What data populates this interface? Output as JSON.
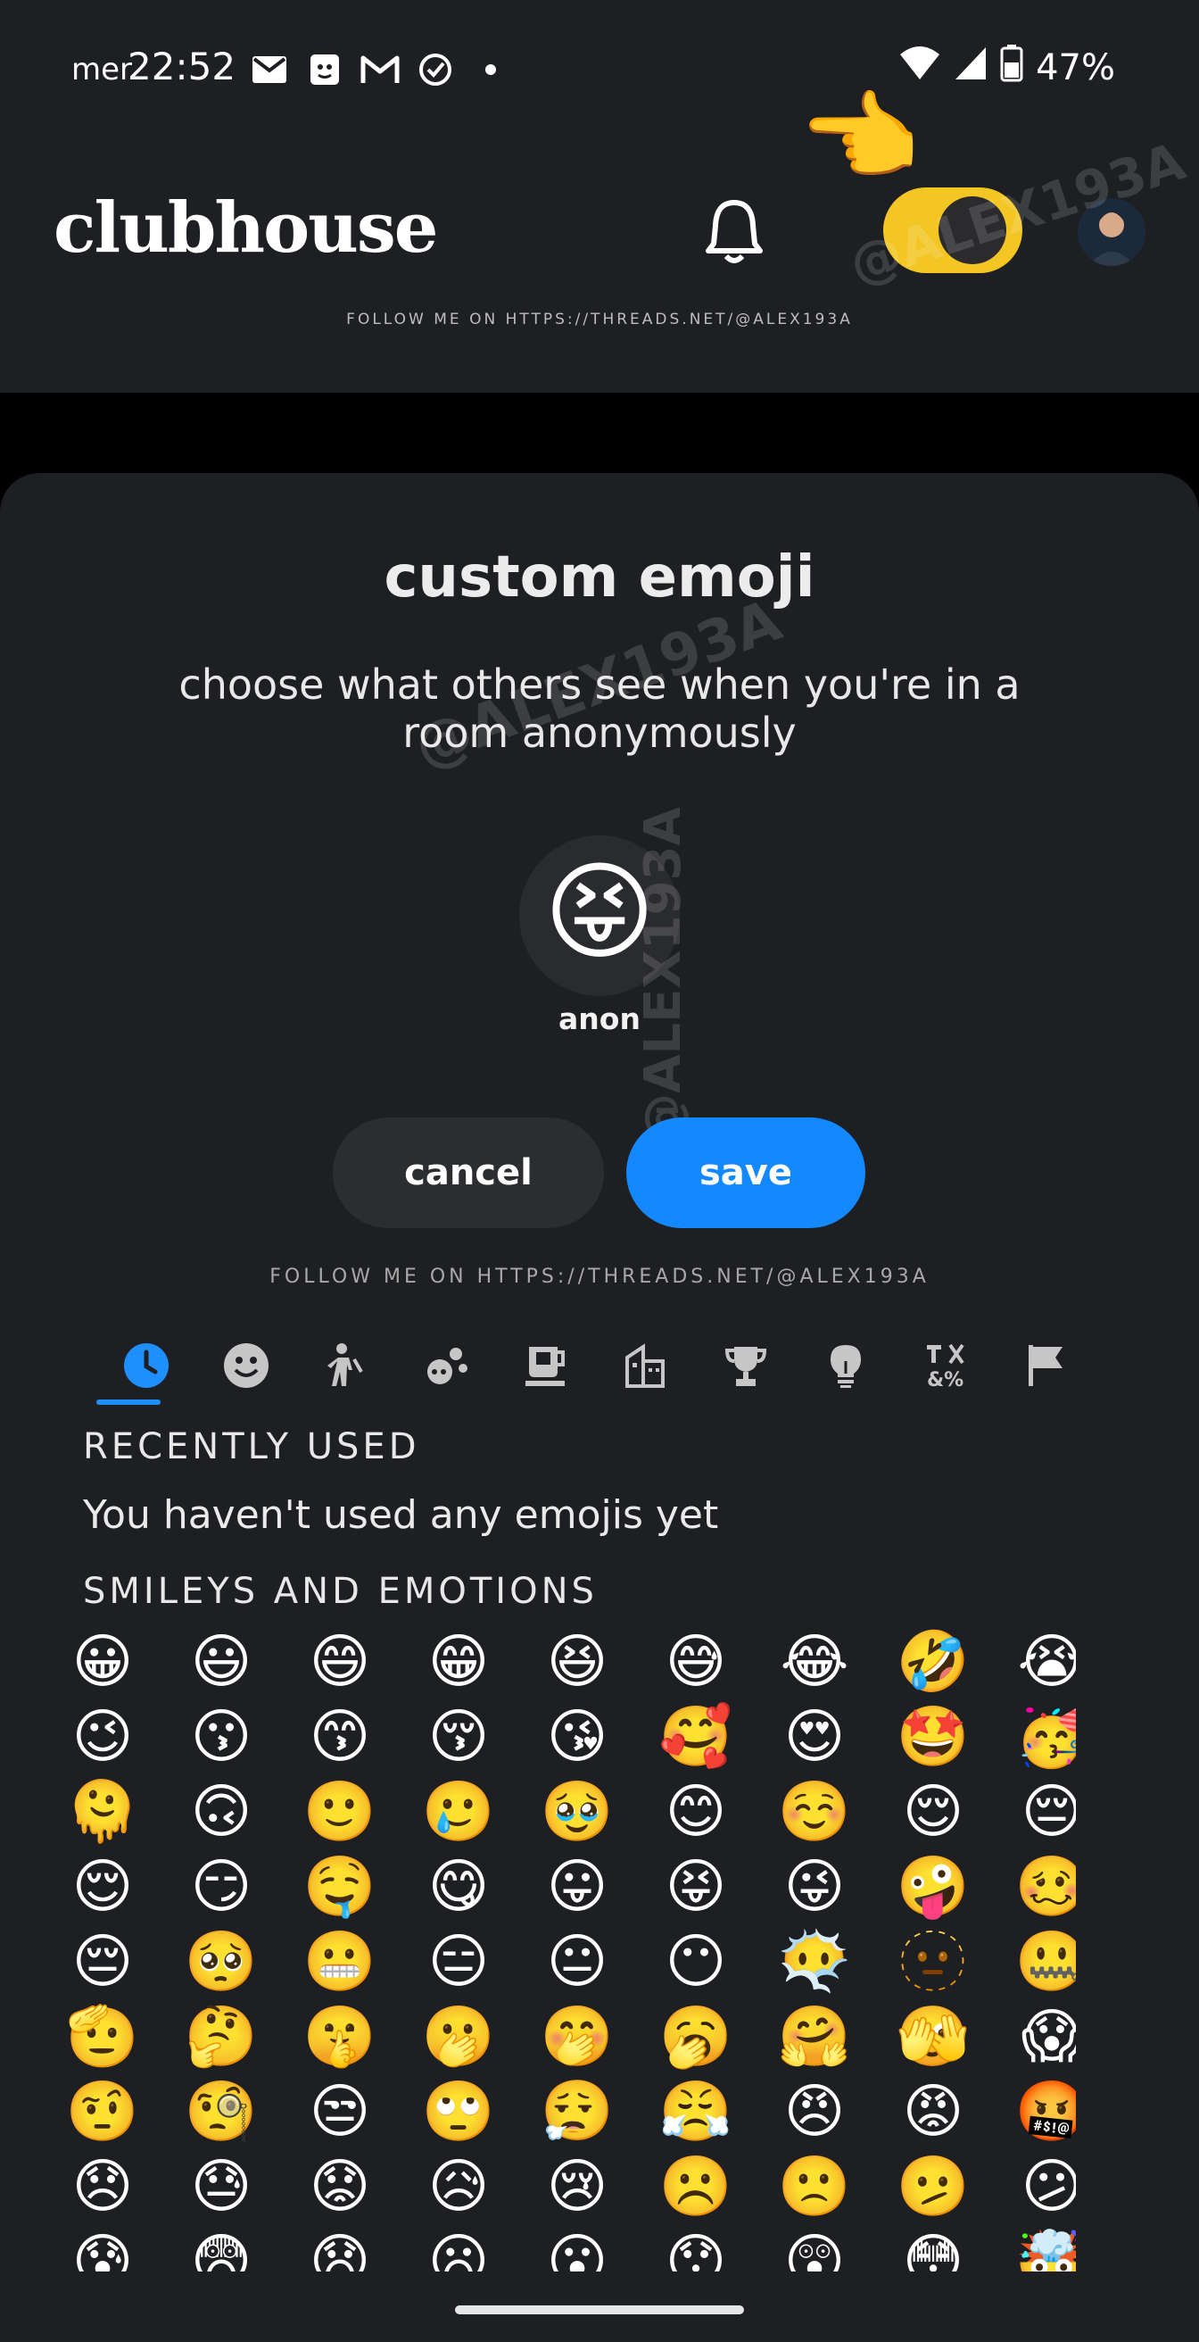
{
  "status_bar": {
    "day": "mer",
    "time": "22:52",
    "battery": "47%",
    "notification_icons": [
      "mail-icon",
      "app-notification-icon",
      "gmail-icon",
      "check-circle-icon",
      "dot-icon"
    ]
  },
  "header": {
    "logo": "clubhouse",
    "follow_banner": "FOLLOW ME ON HTTPS://THREADS.NET/@ALEX193A",
    "watermark": "@ALEX193A",
    "pointer_emoji": "👈"
  },
  "sheet": {
    "title": "custom emoji",
    "subtitle": "choose what others see when you're in a room anonymously",
    "selected_emoji": "😝",
    "selected_label": "anon",
    "cancel_label": "cancel",
    "save_label": "save",
    "follow_banner": "FOLLOW ME ON HTTPS://THREADS.NET/@ALEX193A",
    "watermark": "@ALEX193A"
  },
  "tabs": [
    {
      "icon": "recent-clock-icon",
      "active": true
    },
    {
      "icon": "smiley-icon",
      "active": false
    },
    {
      "icon": "person-icon",
      "active": false
    },
    {
      "icon": "animals-nature-icon",
      "active": false
    },
    {
      "icon": "food-drink-icon",
      "active": false
    },
    {
      "icon": "travel-places-icon",
      "active": false
    },
    {
      "icon": "activities-trophy-icon",
      "active": false
    },
    {
      "icon": "objects-bulb-icon",
      "active": false
    },
    {
      "icon": "symbols-icon",
      "active": false
    },
    {
      "icon": "flags-icon",
      "active": false
    }
  ],
  "recent": {
    "heading": "RECENTLY USED",
    "empty_text": "You haven't used any emojis yet"
  },
  "smileys": {
    "heading": "SMILEYS AND EMOTIONS",
    "emojis": [
      "😀",
      "😃",
      "😄",
      "😁",
      "😆",
      "😅",
      "😂",
      "🤣",
      "😭",
      "😉",
      "😗",
      "😙",
      "😚",
      "😘",
      "🥰",
      "😍",
      "🤩",
      "🥳",
      "🫠",
      "🙃",
      "🙂",
      "🥲",
      "🥹",
      "😊",
      "☺️",
      "😌",
      "😔",
      "😌",
      "😏",
      "🤤",
      "😋",
      "😛",
      "😝",
      "😜",
      "🤪",
      "🥴",
      "😔",
      "🥺",
      "😬",
      "😑",
      "😐",
      "😶",
      "😶‍🌫️",
      "🫥",
      "🤐",
      "🫡",
      "🤔",
      "🤫",
      "🫢",
      "🤭",
      "🥱",
      "🤗",
      "🫣",
      "😱",
      "🤨",
      "🧐",
      "😒",
      "🙄",
      "😮‍💨",
      "😤",
      "😠",
      "😡",
      "🤬",
      "😞",
      "😓",
      "😟",
      "😥",
      "😢",
      "☹️",
      "🙁",
      "🫤",
      "😕",
      "😰",
      "😨",
      "😧",
      "😦",
      "😮",
      "😯",
      "😲",
      "😳",
      "🤯"
    ]
  },
  "colors": {
    "background": "#1e1f22",
    "accent": "#1388ff",
    "toggle": "#f3c623"
  }
}
